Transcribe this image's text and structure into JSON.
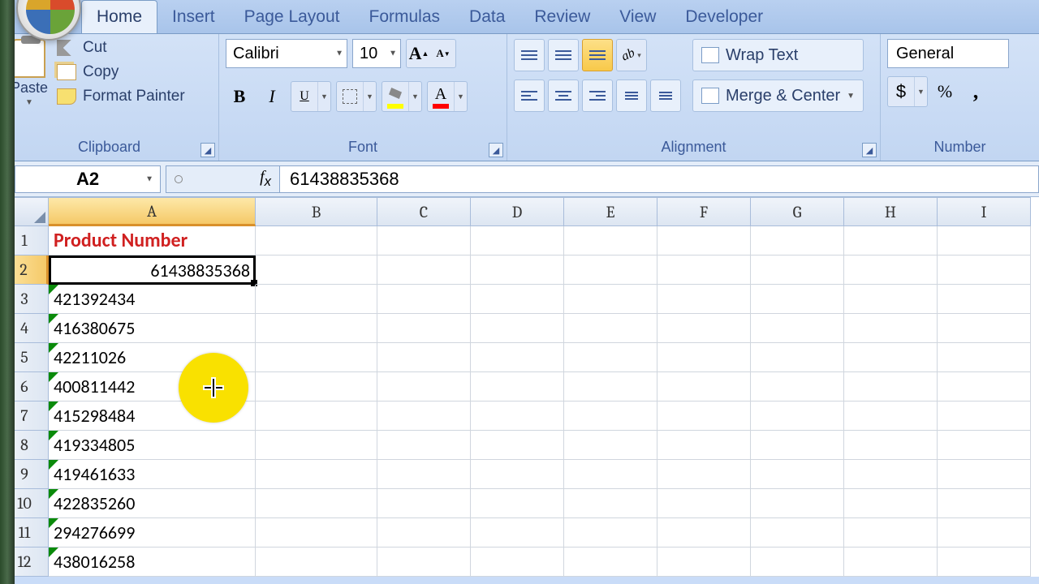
{
  "tabs": [
    "Home",
    "Insert",
    "Page Layout",
    "Formulas",
    "Data",
    "Review",
    "View",
    "Developer"
  ],
  "active_tab": "Home",
  "clipboard": {
    "label": "Clipboard",
    "paste": "Paste",
    "cut": "Cut",
    "copy": "Copy",
    "format_painter": "Format Painter"
  },
  "font": {
    "label": "Font",
    "name": "Calibri",
    "size": "10"
  },
  "alignment": {
    "label": "Alignment",
    "wrap": "Wrap Text",
    "merge": "Merge & Center"
  },
  "number": {
    "label": "Number",
    "format": "General",
    "currency": "$",
    "percent": "%",
    "comma": ","
  },
  "namebox": "A2",
  "formula": "61438835368",
  "columns": [
    "A",
    "B",
    "C",
    "D",
    "E",
    "F",
    "G",
    "H",
    "I"
  ],
  "rows": [
    {
      "n": "1",
      "a": "Product Number",
      "header": true
    },
    {
      "n": "2",
      "a": "61438835368",
      "sel": true
    },
    {
      "n": "3",
      "a": "421392434",
      "tri": true
    },
    {
      "n": "4",
      "a": "416380675",
      "tri": true
    },
    {
      "n": "5",
      "a": "42211026",
      "tri": true
    },
    {
      "n": "6",
      "a": "400811442",
      "tri": true
    },
    {
      "n": "7",
      "a": "415298484",
      "tri": true
    },
    {
      "n": "8",
      "a": "419334805",
      "tri": true
    },
    {
      "n": "9",
      "a": "419461633",
      "tri": true
    },
    {
      "n": "10",
      "a": "422835260",
      "tri": true
    },
    {
      "n": "11",
      "a": "294276699",
      "tri": true
    },
    {
      "n": "12",
      "a": "438016258",
      "tri": true
    }
  ],
  "chart_data": null
}
